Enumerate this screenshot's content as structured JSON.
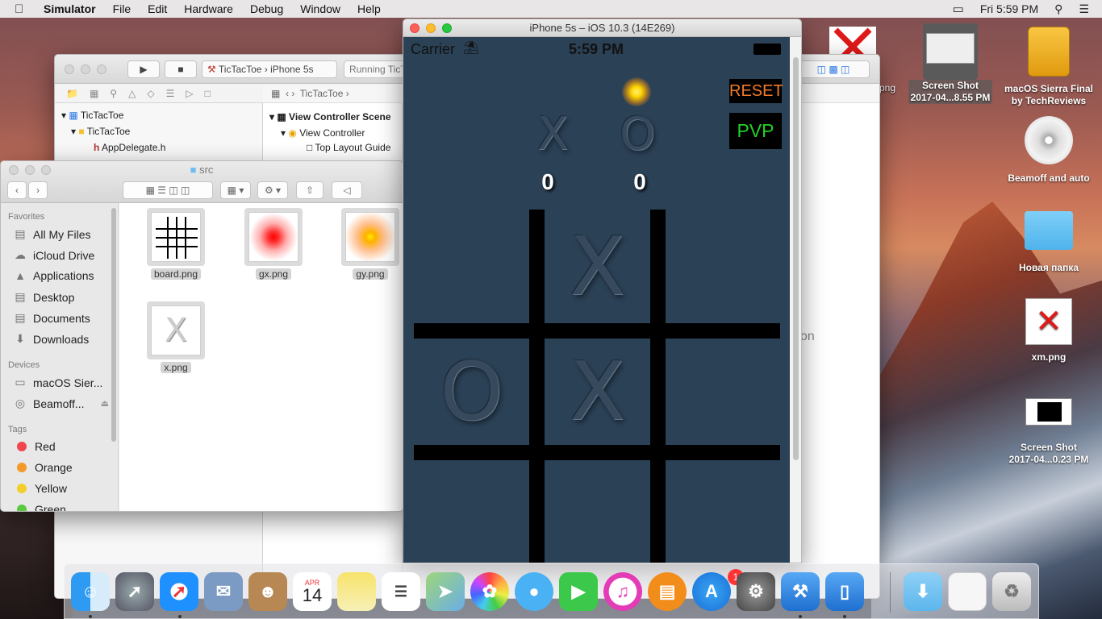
{
  "menubar": {
    "app": "Simulator",
    "items": [
      "File",
      "Edit",
      "Hardware",
      "Debug",
      "Window",
      "Help"
    ],
    "clock": "Fri 5:59 PM"
  },
  "xcode": {
    "project": "TicTacToe",
    "device": "iPhone 5s",
    "status": "Running TicTacToe",
    "breadcrumb": "TicTacToe",
    "tree": [
      "TicTacToe",
      "TicTacToe",
      "AppDelegate.h"
    ],
    "outline": [
      "View Controller Scene",
      "View Controller",
      "Top Layout Guide"
    ],
    "partial_right": "on"
  },
  "finder": {
    "title": "src",
    "favorites_header": "Favorites",
    "favorites": [
      "All My Files",
      "iCloud Drive",
      "Applications",
      "Desktop",
      "Documents",
      "Downloads"
    ],
    "devices_header": "Devices",
    "devices": [
      "macOS Sier...",
      "Beamoff..."
    ],
    "tags_header": "Tags",
    "tags": [
      {
        "label": "Red",
        "color": "#f0474f"
      },
      {
        "label": "Orange",
        "color": "#f39a2b"
      },
      {
        "label": "Yellow",
        "color": "#f4cf2c"
      },
      {
        "label": "Green",
        "color": "#5bc842"
      }
    ],
    "files": [
      "board.png",
      "gx.png",
      "gy.png",
      "x.png"
    ]
  },
  "simulator": {
    "title": "iPhone 5s – iOS 10.3 (14E269)",
    "carrier": "Carrier",
    "time": "5:59 PM",
    "reset": "RESET",
    "mode": "PVP",
    "player_x": "X",
    "player_o": "O",
    "score_x": "0",
    "score_o": "0",
    "board": [
      "",
      "X",
      "",
      "O",
      "X",
      "",
      "",
      "",
      ""
    ],
    "colors": {
      "reset": "#f07a2a",
      "mode": "#22d022",
      "bg": "#2b4156"
    }
  },
  "desktop": {
    "icons": [
      "Screen Shot\n2017-04...8.55 PM",
      "macOS Sierra Final\nby TechReviews",
      "Beamoff and auto",
      "Новая папка",
      "xm.png",
      "Screen Shot\n2017-04...0.23 PM"
    ],
    "partial_label": "png"
  },
  "dock": {
    "badge": "1",
    "calendar_month": "APR",
    "calendar_day": "14"
  }
}
